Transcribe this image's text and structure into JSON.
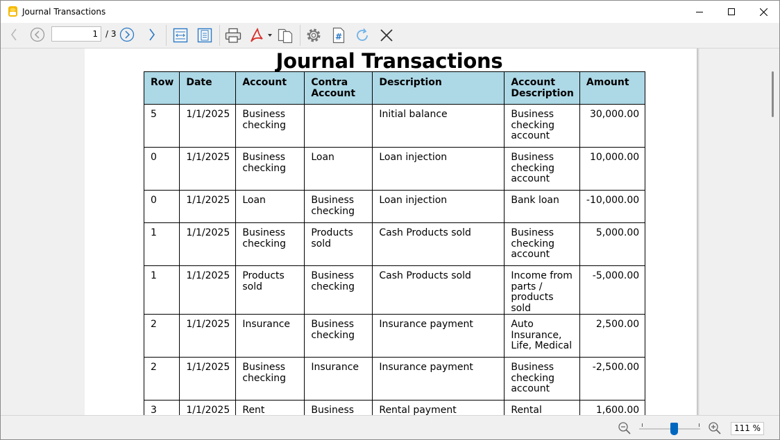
{
  "window": {
    "title": "Journal Transactions",
    "controls": {
      "minimize": "minimize",
      "maximize": "maximize",
      "close": "close"
    }
  },
  "toolbar": {
    "page_current": "1",
    "page_total": "/ 3",
    "icons": [
      "arrow-left-icon",
      "circle-prev-icon",
      "circle-next-icon",
      "arrow-right-icon",
      "fit-width-icon",
      "fit-page-icon",
      "print-icon",
      "pdf-icon",
      "copy-icon",
      "settings-icon",
      "hash-document-icon",
      "refresh-icon",
      "close-icon"
    ]
  },
  "document": {
    "title": "Journal Transactions",
    "columns": [
      "Row",
      "Date",
      "Account",
      "Contra Account",
      "Description",
      "Account Description",
      "Amount"
    ],
    "rows": [
      {
        "row": "5",
        "date": "1/1/2025",
        "account": "Business checking",
        "contra": "",
        "description": "Initial balance",
        "account_description": "Business checking account",
        "amount": "30,000.00"
      },
      {
        "row": "0",
        "date": "1/1/2025",
        "account": "Business checking",
        "contra": "Loan",
        "description": "Loan injection",
        "account_description": "Business checking account",
        "amount": "10,000.00"
      },
      {
        "row": "0",
        "date": "1/1/2025",
        "account": "Loan",
        "contra": "Business checking",
        "description": "Loan injection",
        "account_description": "Bank loan",
        "amount": "-10,000.00"
      },
      {
        "row": "1",
        "date": "1/1/2025",
        "account": "Business checking",
        "contra": "Products sold",
        "description": "Cash Products sold",
        "account_description": "Business checking account",
        "amount": "5,000.00"
      },
      {
        "row": "1",
        "date": "1/1/2025",
        "account": "Products sold",
        "contra": "Business checking",
        "description": "Cash Products sold",
        "account_description": "Income from parts / products sold",
        "amount": "-5,000.00"
      },
      {
        "row": "2",
        "date": "1/1/2025",
        "account": "Insurance",
        "contra": "Business checking",
        "description": "Insurance payment",
        "account_description": "Auto Insurance, Life, Medical",
        "amount": "2,500.00"
      },
      {
        "row": "2",
        "date": "1/1/2025",
        "account": "Business checking",
        "contra": "Insurance",
        "description": "Insurance payment",
        "account_description": "Business checking account",
        "amount": "-2,500.00"
      },
      {
        "row": "3",
        "date": "1/1/2025",
        "account": "Rent",
        "contra": "Business checking",
        "description": "Rental payment",
        "account_description": "Rental Payments",
        "amount": "1,600.00"
      }
    ]
  },
  "statusbar": {
    "zoom": "111 %",
    "zoom_level_percent": 111,
    "icons": [
      "zoom-out-icon",
      "zoom-in-icon"
    ]
  },
  "colors": {
    "header_fill": "#add8e6",
    "accent": "#0067c0",
    "app_icon": "#f5b800"
  }
}
